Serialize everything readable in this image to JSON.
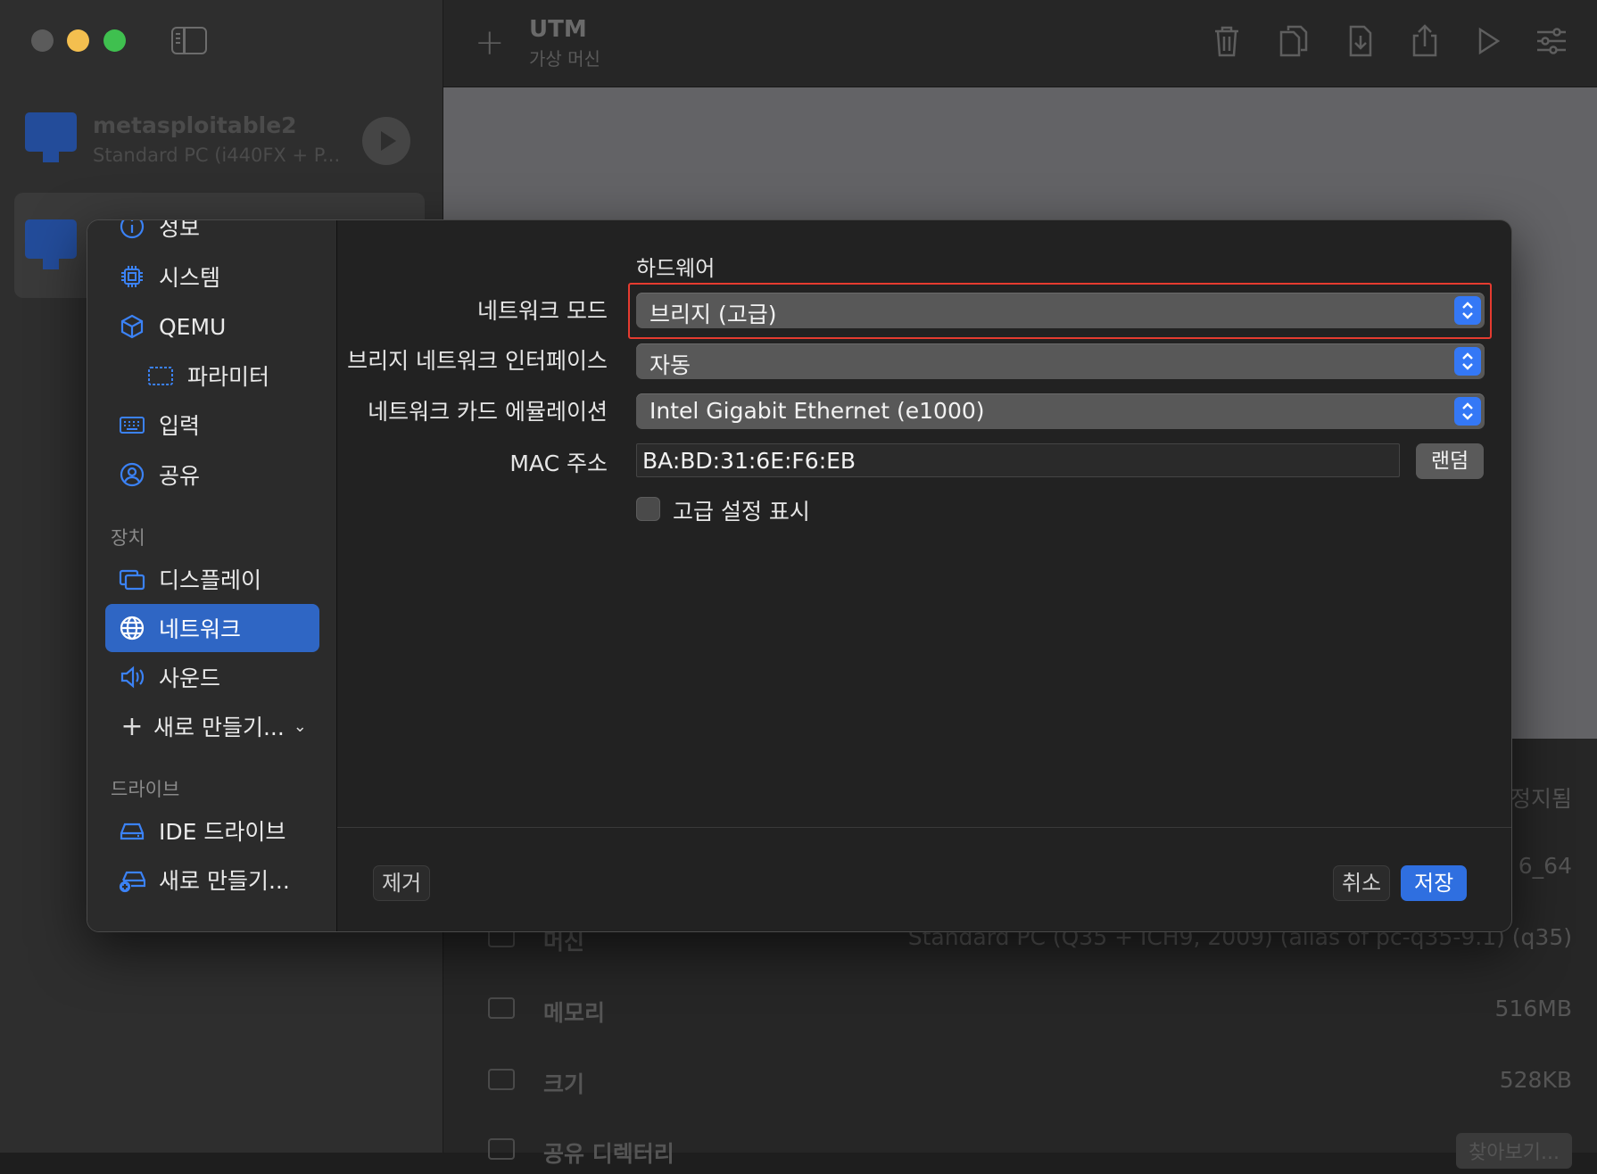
{
  "window": {
    "title": "UTM",
    "subtitle": "가상 머신"
  },
  "vms": [
    {
      "name": "metasploitable2",
      "subtitle": "Standard PC (i440FX + P..."
    }
  ],
  "details": [
    {
      "label": "",
      "value": "정지됨"
    },
    {
      "label": "",
      "value": "6_64"
    },
    {
      "label": "머신",
      "value": "Standard PC (Q35 + ICH9, 2009) (alias of pc-q35-9.1) (q35)"
    },
    {
      "label": "메모리",
      "value": "516MB"
    },
    {
      "label": "크기",
      "value": "528KB"
    },
    {
      "label": "공유 디렉터리",
      "button": "찾아보기..."
    }
  ],
  "settings_nav": {
    "items": [
      {
        "label": "정보",
        "icon": "info-icon"
      },
      {
        "label": "시스템",
        "icon": "cpu-icon"
      },
      {
        "label": "QEMU",
        "icon": "cube-icon"
      },
      {
        "label": "파라미터",
        "icon": "parameter-icon"
      },
      {
        "label": "입력",
        "icon": "keyboard-icon"
      },
      {
        "label": "공유",
        "icon": "person-circle-icon"
      }
    ],
    "devices_header": "장치",
    "devices": [
      {
        "label": "디스플레이",
        "icon": "display-icon"
      },
      {
        "label": "네트워크",
        "icon": "globe-icon"
      },
      {
        "label": "사운드",
        "icon": "speaker-icon"
      }
    ],
    "new_device": "새로 만들기...",
    "drives_header": "드라이브",
    "drives": [
      {
        "label": "IDE 드라이브",
        "icon": "drive-icon"
      },
      {
        "label": "새로 만들기...",
        "icon": "drive-add-icon"
      }
    ]
  },
  "network": {
    "section_title": "하드웨어",
    "mode_label": "네트워크 모드",
    "mode_value": "브리지 (고급)",
    "bridge_label": "브리지 네트워크 인터페이스",
    "bridge_value": "자동",
    "card_label": "네트워크 카드 에뮬레이션",
    "card_value": "Intel Gigabit Ethernet (e1000)",
    "mac_label": "MAC 주소",
    "mac_value": "BA:BD:31:6E:F6:EB",
    "random_button": "랜덤",
    "advanced_label": "고급 설정 표시"
  },
  "footer": {
    "remove": "제거",
    "cancel": "취소",
    "save": "저장"
  },
  "colors": {
    "accent": "#3478f6",
    "selected": "#2f66c4",
    "highlight": "#e53b30"
  }
}
